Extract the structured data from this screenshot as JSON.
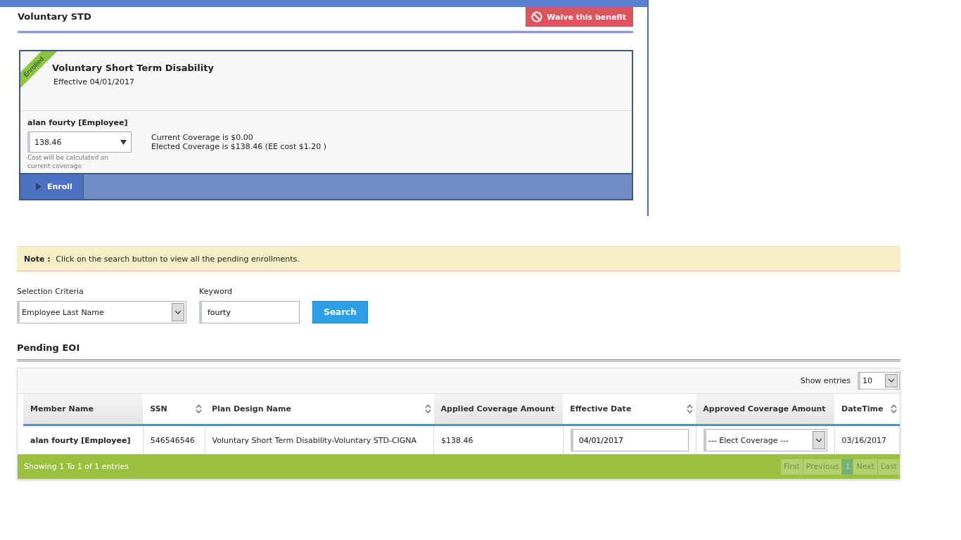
{
  "benefit_panel": {
    "title": "Voluntary STD",
    "waive_button": "Waive this benefit",
    "plan": {
      "ribbon": "Enrolled",
      "name": "Voluntary Short Term Disability",
      "effective": "Effective 04/01/2017",
      "member": {
        "name": "alan fourty [Employee]",
        "coverage_select": "138.46",
        "hint": "Cost will be calculated on current coverage",
        "current": "Current Coverage is $0.00",
        "elected": "Elected Coverage is $138.46 (EE cost $1.20 )"
      },
      "enroll_button": "Enroll"
    }
  },
  "note": {
    "label": "Note :",
    "text": "Click on the search button to view all the pending enrollments."
  },
  "search_form": {
    "criteria_label": "Selection Criteria",
    "criteria_value": "Employee Last Name",
    "keyword_label": "Keyword",
    "keyword_value": "fourty",
    "search_button": "Search"
  },
  "pending_eoi": {
    "title": "Pending EOI",
    "show_entries_label": "Show entries",
    "show_entries_value": "10",
    "table": {
      "columns": [
        {
          "label": "Member Name",
          "sortable": false
        },
        {
          "label": "SSN",
          "sortable": true
        },
        {
          "label": "Plan Design Name",
          "sortable": true
        },
        {
          "label": "Applied Coverage Amount",
          "sortable": false
        },
        {
          "label": "Effective Date",
          "sortable": true
        },
        {
          "label": "Approved Coverage Amount",
          "sortable": false
        },
        {
          "label": "DateTime",
          "sortable": true
        }
      ],
      "rows": [
        {
          "cells": [
            {
              "kind": "bold",
              "text": "alan fourty [Employee]"
            },
            {
              "kind": "text",
              "text": "546546546"
            },
            {
              "kind": "text",
              "text": "Voluntary Short Term Disability-Voluntary STD-CIGNA"
            },
            {
              "kind": "text",
              "text": "$138.46"
            },
            {
              "kind": "input",
              "text": "04/01/2017"
            },
            {
              "kind": "select",
              "text": "--- Elect Coverage ---"
            },
            {
              "kind": "text",
              "text": "03/16/2017"
            }
          ]
        }
      ]
    },
    "footer_info": "Showing 1 To 1 of 1 entries",
    "pager": [
      {
        "label": "First",
        "selected": false
      },
      {
        "label": "Previous",
        "selected": false
      },
      {
        "label": "1",
        "selected": true
      },
      {
        "label": "Next",
        "selected": false
      },
      {
        "label": "Last",
        "selected": false
      }
    ]
  }
}
